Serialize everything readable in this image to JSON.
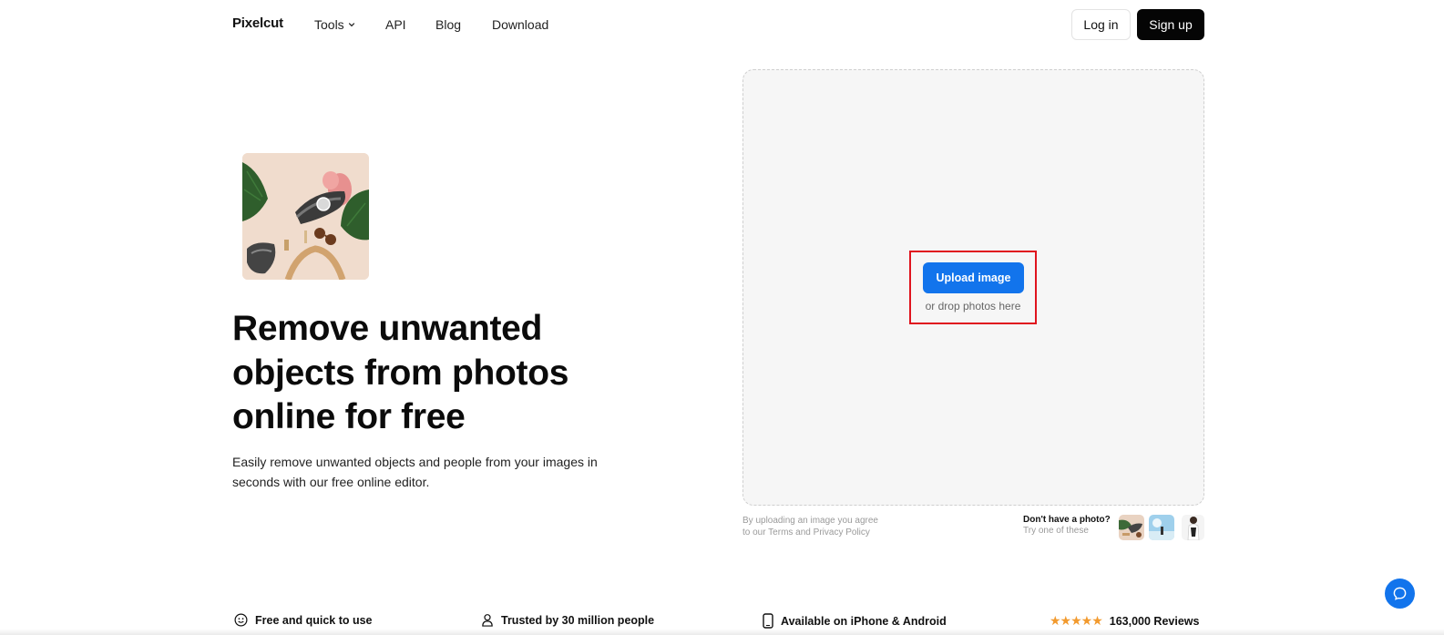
{
  "nav": {
    "logo": "Pixelcut",
    "links": {
      "tools": "Tools",
      "api": "API",
      "blog": "Blog",
      "download": "Download"
    },
    "login": "Log in",
    "signup": "Sign up"
  },
  "hero": {
    "title": "Remove unwanted objects from photos online for free",
    "subtitle": "Easily remove unwanted objects and people from your images in seconds with our free online editor."
  },
  "upload": {
    "button": "Upload image",
    "hint": "or drop photos here",
    "terms_line1": "By uploading an image you agree",
    "terms_prefix": "to our ",
    "terms_link": "Terms",
    "terms_and": " and ",
    "privacy_link": "Privacy Policy",
    "no_photo": "Don't have a photo?",
    "try_one": "Try one of these"
  },
  "features": {
    "free": "Free and quick to use",
    "trusted": "Trusted by 30 million people",
    "available": "Available on iPhone & Android",
    "stars": "★★★★★",
    "reviews": "163,000 Reviews"
  },
  "colors": {
    "accent": "#1274ec",
    "highlight_border": "#e0141e",
    "star": "#f29a2e"
  },
  "icons": {
    "tools_chevron": "chevron-down-icon",
    "free": "smiley-icon",
    "trusted": "person-icon",
    "available": "phone-icon",
    "chat": "chat-bubble-icon"
  }
}
